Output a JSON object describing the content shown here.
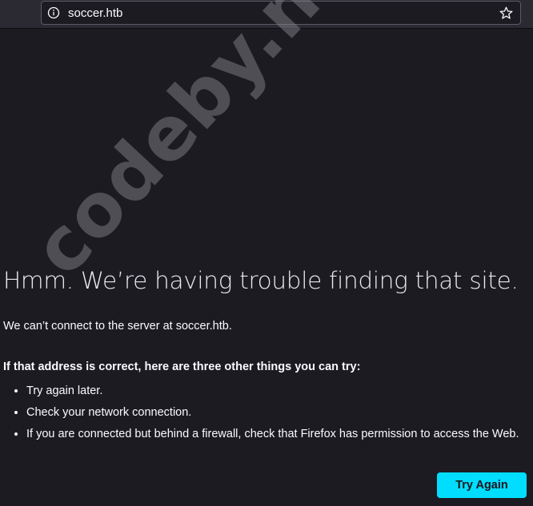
{
  "browser": {
    "url": "soccer.htb",
    "icons": {
      "info": "info-icon",
      "bookmark": "star-icon"
    }
  },
  "error_page": {
    "title": "Hmm. We’re having trouble finding that site.",
    "description": "We can’t connect to the server at soccer.htb.",
    "subhead": "If that address is correct, here are three other things you can try:",
    "tips": [
      "Try again later.",
      "Check your network connection.",
      "If you are connected but behind a firewall, check that Firefox has permission to access the Web."
    ],
    "button_label": "Try Again"
  },
  "watermark": "codeby.net",
  "colors": {
    "background": "#1c1b22",
    "toolbar": "#2b2a33",
    "accent": "#00ddff"
  }
}
